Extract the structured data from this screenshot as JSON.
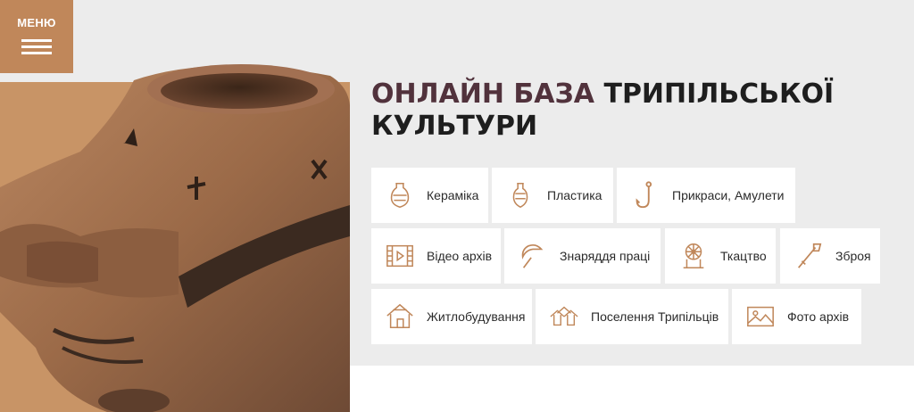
{
  "menu": {
    "label": "МЕНЮ",
    "icon": "hamburger-icon"
  },
  "hero": {
    "title_accent": "ОНЛАЙН БАЗА",
    "title_rest": "ТРИПІЛЬСЬКОЇ",
    "title_line2": "КУЛЬТУРИ"
  },
  "categories": [
    {
      "label": "Кераміка",
      "icon": "vase-icon"
    },
    {
      "label": "Пластика",
      "icon": "figurine-icon"
    },
    {
      "label": "Прикраси, Амулети",
      "icon": "hook-amulet-icon"
    },
    {
      "label": "Відео архів",
      "icon": "film-video-icon"
    },
    {
      "label": "Знаряддя праці",
      "icon": "sickle-icon"
    },
    {
      "label": "Ткацтво",
      "icon": "spinning-wheel-icon"
    },
    {
      "label": "Зброя",
      "icon": "spear-icon"
    },
    {
      "label": "Житлобудування",
      "icon": "house-icon"
    },
    {
      "label": "Поселення Трипільців",
      "icon": "village-icon"
    },
    {
      "label": "Фото архів",
      "icon": "photo-icon"
    }
  ],
  "colors": {
    "accent": "#c0875a",
    "title_accent": "#51323c",
    "icon": "#c0875a",
    "background": "#ececec"
  }
}
